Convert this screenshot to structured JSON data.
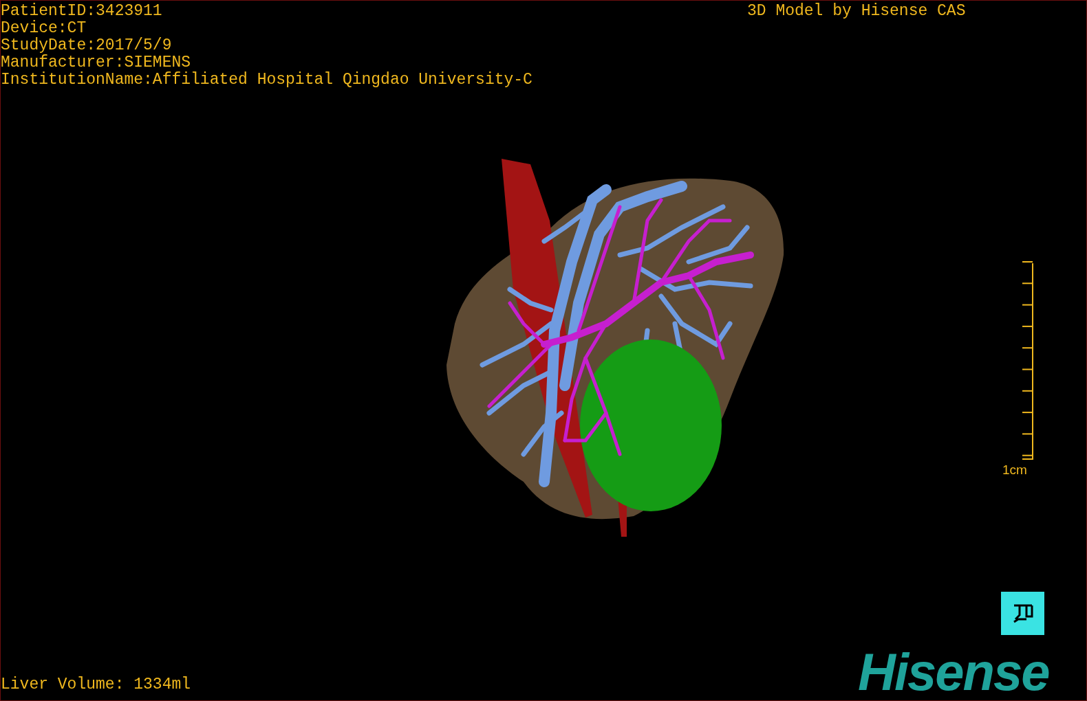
{
  "patient_info": [
    "PatientID:3423911",
    "Device:CT",
    "StudyDate:2017/5/9",
    "Manufacturer:SIEMENS",
    "InstitutionName:Affiliated Hospital Qingdao University-C"
  ],
  "model_credit": "3D Model by Hisense CAS",
  "scale_bar": {
    "label": "1cm"
  },
  "liver_volume": "Liver Volume: 1334ml",
  "logo": "Hisense"
}
